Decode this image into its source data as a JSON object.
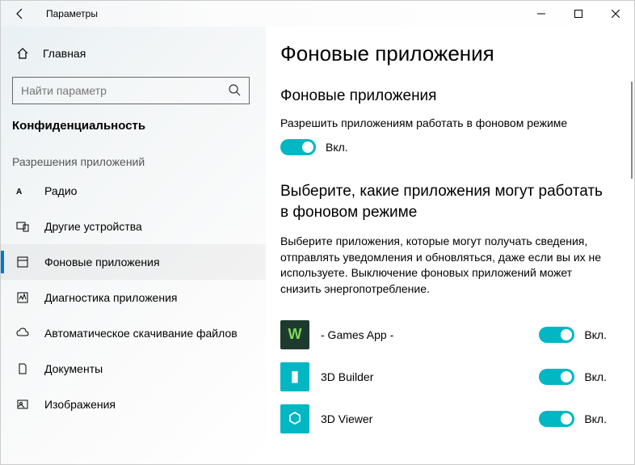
{
  "window": {
    "title": "Параметры"
  },
  "sidebar": {
    "home": "Главная",
    "search_placeholder": "Найти параметр",
    "category": "Конфиденциальность",
    "group_title": "Разрешения приложений",
    "items": [
      {
        "label": "Радио"
      },
      {
        "label": "Другие устройства"
      },
      {
        "label": "Фоновые приложения"
      },
      {
        "label": "Диагностика приложения"
      },
      {
        "label": "Автоматическое скачивание файлов"
      },
      {
        "label": "Документы"
      },
      {
        "label": "Изображения"
      }
    ]
  },
  "main": {
    "title": "Фоновые приложения",
    "section1_title": "Фоновые приложения",
    "allow_label": "Разрешить приложениям работать в фоновом режиме",
    "toggle_on": "Вкл.",
    "section2_title": "Выберите, какие приложения могут работать в фоновом режиме",
    "section2_desc": "Выберите приложения, которые могут получать сведения, отправлять уведомления и обновляться, даже если вы их не используете. Выключение фоновых приложений может снизить энергопотребление.",
    "apps": [
      {
        "name": "- Games App -",
        "state": "Вкл.",
        "icon_bg": "#1e3a2e",
        "icon_text": "W",
        "icon_color": "#7ed957"
      },
      {
        "name": "3D Builder",
        "state": "Вкл.",
        "icon_bg": "#00b7c3",
        "icon_text": "▮",
        "icon_color": "#fff"
      },
      {
        "name": "3D Viewer",
        "state": "Вкл.",
        "icon_bg": "#00b7c3",
        "icon_text": "⬡",
        "icon_color": "#fff"
      }
    ]
  }
}
